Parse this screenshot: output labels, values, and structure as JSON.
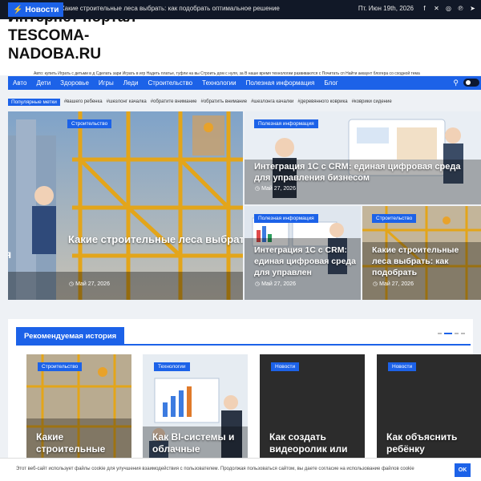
{
  "topbar": {
    "badge": "Новости",
    "ticker": "Какие строительные леса выбрать: как подобрать оптимальное решение",
    "date": "Пт. Июн 19th, 2026",
    "social": [
      "facebook-icon",
      "x-icon",
      "instagram-icon",
      "pinterest-icon",
      "telegram-icon"
    ]
  },
  "header": {
    "title": "Интернет портал TESCOMA-NADOBA.RU",
    "promo": "Авто: купить Играть с детьми в д Сделать зари Играть в игр Надеть платье, туфли на вы Строить дом с нуля, за В наше время технологии развиваются с Почитать сп Найти аккаунт блогера со сходной тема"
  },
  "nav": {
    "items": [
      "Авто",
      "Дети",
      "Здоровье",
      "Игры",
      "Леди",
      "Строительство",
      "Технологии",
      "Полезная информация",
      "Блог"
    ]
  },
  "tags": {
    "label": "Популярные метки",
    "items": [
      "#вашего ребенка",
      "#шезлонг качалка",
      "#обратите внимание",
      "#обратить внимание",
      "#шезлонга качалки",
      "#деревянного коврика",
      "#коврики сидение"
    ]
  },
  "hero": {
    "main": {
      "category": "Строительство",
      "title": "Какие строительные леса выбрать: как подобрать оптимальное решение для высотных работ",
      "date": "Май 27, 2026"
    },
    "top_right": {
      "category": "Полезная информация",
      "title": "Интеграция 1С с CRM: единая цифровая среда для управления бизнесом",
      "date": "Май 27, 2026"
    },
    "bottom_left": {
      "category": "Полезная информация",
      "title": "Интеграция 1С с CRM: единая цифровая среда для управлен",
      "date": "Май 27, 2026"
    },
    "bottom_right": {
      "category": "Строительство",
      "title": "Какие строительные леса выбрать: как подобрать",
      "date": "Май 27, 2026"
    },
    "left_edge": "я"
  },
  "recommended": {
    "heading": "Рекомендуемая история",
    "cards": [
      {
        "category": "Строительство",
        "title": "Какие строительные"
      },
      {
        "category": "Технологии",
        "title": "Как BI-системы и облачные"
      },
      {
        "category": "Новости",
        "title": "Как создать видеоролик или"
      },
      {
        "category": "Новости",
        "title": "Как объяснить ребёнку"
      }
    ]
  },
  "cookie": {
    "text": "Этот веб-сайт использует файлы cookie для улучшения взаимодействия с пользователем. Продолжая пользоваться сайтом, вы даете согласие на использование файлов cookie",
    "button": "OK"
  },
  "colors": {
    "accent": "#1c62e8",
    "topbar": "#111827"
  }
}
